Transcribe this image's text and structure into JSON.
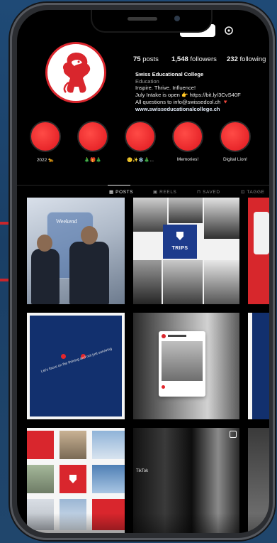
{
  "profile": {
    "posts": "75",
    "posts_label": "posts",
    "followers": "1,548",
    "followers_label": "followers",
    "following": "232",
    "following_label": "following",
    "name": "Swiss Educational College",
    "category": "Education",
    "bio_lines": [
      "Inspire. Thrive. Influence!",
      "July Intake is open 👉 https://bit.ly/3CvS40F",
      "All questions to info@swissedcol.ch 🔻"
    ],
    "website": "www.swisseducationalcollege.ch"
  },
  "highlights": [
    {
      "label": "2022 🐆"
    },
    {
      "label": "🎄🎁🎄"
    },
    {
      "label": "🙂✨❄️🎄..."
    },
    {
      "label": "Memories!"
    },
    {
      "label": "Digital Lion!"
    }
  ],
  "tabs": [
    {
      "label": "POSTS"
    },
    {
      "label": "REELS"
    },
    {
      "label": "SAVED"
    },
    {
      "label": "TAGGE"
    }
  ],
  "posts": {
    "weekend_title": "Weekend",
    "trips_label": "TRIPS",
    "smile_text": "Let's focus on the thriving and not just surviving",
    "tiktok_label": "TikTok"
  },
  "colors": {
    "brand_red": "#d9262d",
    "brand_navy": "#12306e",
    "background": "#000000",
    "text": "#f2f2f2"
  }
}
